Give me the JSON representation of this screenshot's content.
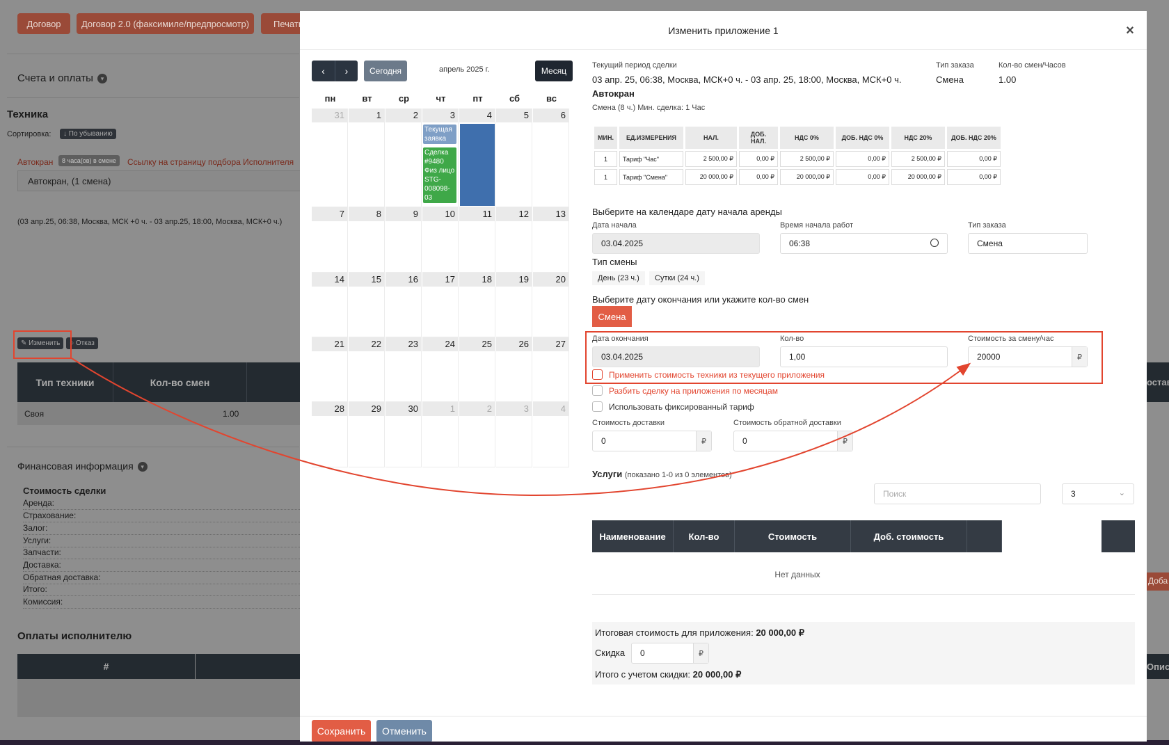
{
  "background": {
    "buttons": [
      "Договор",
      "Договор 2.0 (факсимиле/предпросмотр)",
      "Печать"
    ],
    "accounts_section": "Счета и оплаты",
    "equipment_title": "Техника",
    "sort_label": "Сортировка:",
    "sort_badge": "По убыванию",
    "machine_link": "Автокран",
    "shift_badge": "8 часа(ов) в смене",
    "executor_link": "Ссылку на страницу подбора Исполнителя",
    "machine_input": "Автокран, (1 смена)",
    "period_text": "(03 апр.25, 06:38, Москва, МСК +0 ч. - 03 апр.25, 18:00, Москва, МСК+0 ч.)",
    "edit_button": "Изменить",
    "refuse_button": "Отказ",
    "table_headers": [
      "Тип техники",
      "Кол-во смен"
    ],
    "table_row": {
      "type": "Своя",
      "count": "1.00"
    },
    "finance_section": "Финансовая информация",
    "deal_cost_title": "Стоимость сделки",
    "finance_items": [
      "Аренда:",
      "Страхование:",
      "Залог:",
      "Услуги:",
      "Запчасти:",
      "Доставка:",
      "Обратная доставка:",
      "Итого:",
      "Комиссия:"
    ],
    "payments_title": "Оплаты исполнителю",
    "payments_header": "#",
    "right_edge_texts": [
      "оставк",
      "Доба",
      "Описа"
    ]
  },
  "modal": {
    "title": "Изменить приложение 1",
    "close": "×",
    "calendar": {
      "prev": "‹",
      "next": "›",
      "today": "Сегодня",
      "month_title": "апрель 2025 г.",
      "view_button": "Месяц",
      "weekdays": [
        "пн",
        "вт",
        "ср",
        "чт",
        "пт",
        "сб",
        "вс"
      ],
      "weeks": [
        [
          "31",
          "1",
          "2",
          "3",
          "4",
          "5",
          "6"
        ],
        [
          "7",
          "8",
          "9",
          "10",
          "11",
          "12",
          "13"
        ],
        [
          "14",
          "15",
          "16",
          "17",
          "18",
          "19",
          "20"
        ],
        [
          "21",
          "22",
          "23",
          "24",
          "25",
          "26",
          "27"
        ],
        [
          "28",
          "29",
          "30",
          "1",
          "2",
          "3",
          "4"
        ]
      ],
      "events": [
        {
          "text": "Текущая заявка",
          "color": "#7f9fc6"
        },
        {
          "text": "Сделка #9480 Физ лицо STG-008098-03",
          "color": "#3fa848"
        }
      ],
      "selected_color": "#3f6fad"
    },
    "period": {
      "label": "Текущий период сделки",
      "value": "03 апр. 25, 06:38, Москва, МСК+0 ч. - 03 апр. 25, 18:00, Москва, МСК+0 ч.",
      "order_type_label": "Тип заказа",
      "order_type_value": "Смена",
      "count_label": "Кол-во смен/Часов",
      "count_value": "1.00",
      "machine": "Автокран",
      "machine_note": "Смена (8 ч.) Мин. сделка: 1 Час"
    },
    "tariff_table": {
      "headers": [
        "МИН.",
        "ЕД.ИЗМЕРЕНИЯ",
        "НАЛ.",
        "ДОБ. НАЛ.",
        "НДС 0%",
        "ДОБ. НДС 0%",
        "НДС 20%",
        "ДОБ. НДС 20%"
      ],
      "rows": [
        [
          "1",
          "Тариф \"Час\"",
          "2 500,00 ₽",
          "0,00 ₽",
          "2 500,00 ₽",
          "0,00 ₽",
          "2 500,00 ₽",
          "0,00 ₽"
        ],
        [
          "1",
          "Тариф \"Смена\"",
          "20 000,00 ₽",
          "0,00 ₽",
          "20 000,00 ₽",
          "0,00 ₽",
          "20 000,00 ₽",
          "0,00 ₽"
        ]
      ]
    },
    "start_section": "Выберите на календаре дату начала аренды",
    "start_date_label": "Дата начала",
    "start_date": "03.04.2025",
    "start_time_label": "Время начала работ",
    "start_time": "06:38",
    "order_type_label": "Тип заказа",
    "order_type": "Смена",
    "shift_type_label": "Тип смены",
    "shift_options": [
      "День (23 ч.)",
      "Сутки (24 ч.)"
    ],
    "end_section": "Выберите дату окончания или укажите кол-во смен",
    "shift_button": "Смена",
    "end_date_label": "Дата окончания",
    "end_date": "03.04.2025",
    "quantity_label": "Кол-во",
    "quantity": "1,00",
    "price_label": "Стоимость за смену/час",
    "price": "20000",
    "currency": "₽",
    "checkboxes": [
      "Применить стоимость техники из текущего приложения",
      "Разбить сделку на приложения по месяцам",
      "Использовать фиксированный тариф"
    ],
    "delivery_label": "Стоимость доставки",
    "delivery": "0",
    "return_delivery_label": "Стоимость обратной доставки",
    "return_delivery": "0",
    "services_title": "Услуги",
    "services_count": "(показано 1-0 из 0 элементов)",
    "search_placeholder": "Поиск",
    "page_size": "3",
    "services_headers": [
      "Наименование",
      "Кол-во",
      "Стоимость",
      "Доб. стоимость"
    ],
    "no_data": "Нет данных",
    "total_label": "Итоговая стоимость для приложения:",
    "total_value": "20 000,00 ₽",
    "discount_label": "Скидка",
    "discount": "0",
    "total_discount_label": "Итого с учетом скидки:",
    "total_discount_value": "20 000,00 ₽",
    "save_button": "Сохранить",
    "cancel_button": "Отменить"
  },
  "colors": {
    "accent": "#e25d45",
    "dark": "#343b44",
    "highlight": "#e2452f"
  }
}
